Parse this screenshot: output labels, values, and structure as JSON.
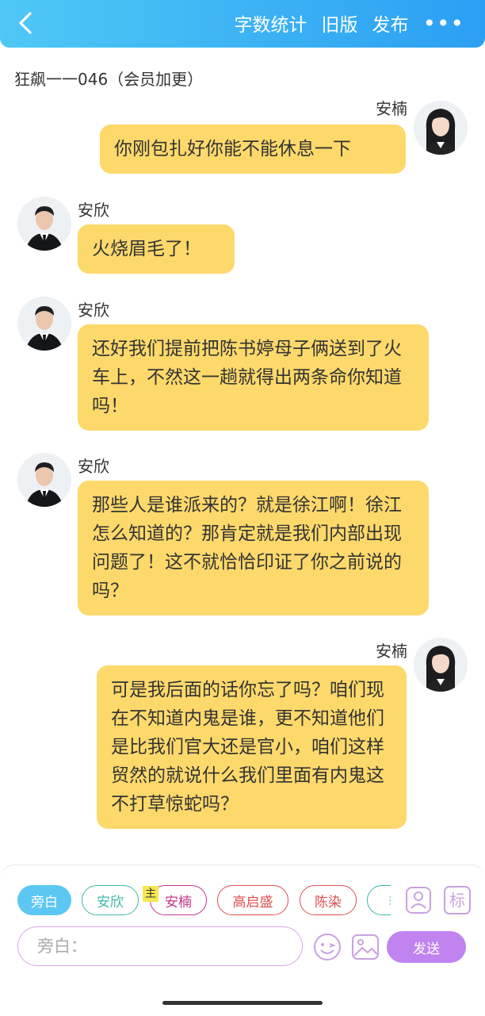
{
  "header": {
    "back_icon": "chevron-left-icon",
    "actions": [
      "字数统计",
      "旧版",
      "发布"
    ],
    "more_label": "•••"
  },
  "story_title": "狂飙一一046（会员加更）",
  "messages": [
    {
      "speaker": "安楠",
      "side": "right",
      "text": "你刚包扎好你能不能休息一下"
    },
    {
      "speaker": "安欣",
      "side": "left",
      "text": "火烧眉毛了！"
    },
    {
      "speaker": "安欣",
      "side": "left",
      "text": "还好我们提前把陈书婷母子俩送到了火车上，不然这一趟就得出两条命你知道吗！"
    },
    {
      "speaker": "安欣",
      "side": "left",
      "text": "那些人是谁派来的？就是徐江啊！徐江怎么知道的？那肯定就是我们内部出现问题了！这不就恰恰印证了你之前说的吗？"
    },
    {
      "speaker": "安楠",
      "side": "right",
      "text": "可是我后面的话你忘了吗？咱们现在不知道内鬼是谁，更不知道他们是比我们官大还是官小，咱们这样贸然的就说什么我们里面有内鬼这不打草惊蛇吗？"
    }
  ],
  "roles": [
    {
      "label": "旁白",
      "selected": true
    },
    {
      "label": "安欣",
      "selected": false
    },
    {
      "label": "安楠",
      "selected": false,
      "badge": "主"
    },
    {
      "label": "高启盛",
      "selected": false
    },
    {
      "label": "陈染",
      "selected": false
    },
    {
      "label": "李",
      "selected": false
    }
  ],
  "composer": {
    "placeholder": "旁白：",
    "send_label": "发送",
    "tag_label": "标",
    "icons": [
      "person-card-icon",
      "tag-icon",
      "emoji-icon",
      "image-icon"
    ]
  },
  "colors": {
    "header": "#2b9ff3",
    "bubble": "#fdd96b",
    "send": "#c083f0",
    "chip_selected": "#5cc7f2",
    "chip_anxin": "#3fb8a8",
    "chip_annan": "#c4378b",
    "chip_red": "#e05050"
  }
}
